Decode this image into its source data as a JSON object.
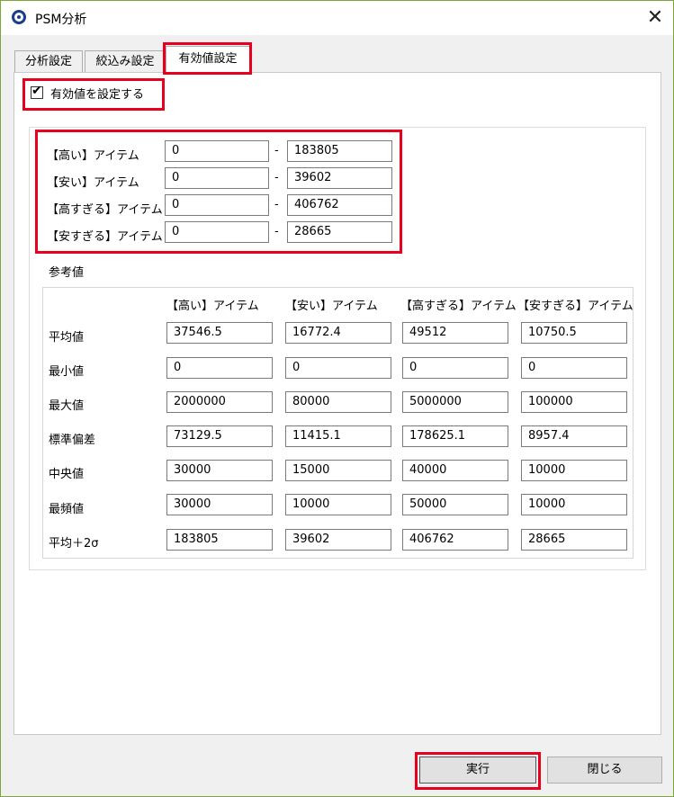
{
  "window": {
    "title": "PSM分析"
  },
  "tabs": [
    {
      "label": "分析設定"
    },
    {
      "label": "絞込み設定"
    },
    {
      "label": "有効値設定"
    }
  ],
  "checkbox": {
    "label": "有効値を設定する",
    "checked": true,
    "mark": "✔"
  },
  "ranges": [
    {
      "label": "【高い】アイテム",
      "min": "0",
      "max": "183805"
    },
    {
      "label": "【安い】アイテム",
      "min": "0",
      "max": "39602"
    },
    {
      "label": "【高すぎる】アイテム",
      "min": "0",
      "max": "406762"
    },
    {
      "label": "【安すぎる】アイテム",
      "min": "0",
      "max": "28665"
    }
  ],
  "range_separator": "-",
  "reference": {
    "title": "参考値",
    "columns": [
      "【高い】アイテム",
      "【安い】アイテム",
      "【高すぎる】アイテム",
      "【安すぎる】アイテム"
    ],
    "rows": [
      {
        "label": "平均値",
        "values": [
          "37546.5",
          "16772.4",
          "49512",
          "10750.5"
        ]
      },
      {
        "label": "最小値",
        "values": [
          "0",
          "0",
          "0",
          "0"
        ]
      },
      {
        "label": "最大値",
        "values": [
          "2000000",
          "80000",
          "5000000",
          "100000"
        ]
      },
      {
        "label": "標準偏差",
        "values": [
          "73129.5",
          "11415.1",
          "178625.1",
          "8957.4"
        ]
      },
      {
        "label": "中央値",
        "values": [
          "30000",
          "15000",
          "40000",
          "10000"
        ]
      },
      {
        "label": "最頻値",
        "values": [
          "30000",
          "10000",
          "50000",
          "10000"
        ]
      },
      {
        "label": "平均＋2σ",
        "values": [
          "183805",
          "39602",
          "406762",
          "28665"
        ]
      }
    ]
  },
  "buttons": {
    "run": "実行",
    "close": "閉じる"
  },
  "icons": {
    "app": "app-logo-icon",
    "close": "close-icon",
    "close_glyph": "✕"
  },
  "colors": {
    "highlight": "#e8001c",
    "window_border": "#7aa63a"
  }
}
